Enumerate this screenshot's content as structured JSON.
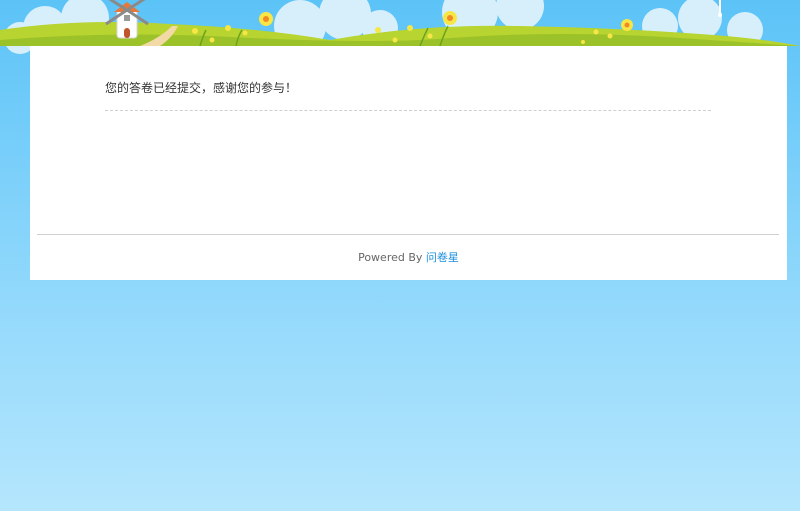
{
  "survey": {
    "submitted_message": "您的答卷已经提交，感谢您的参与！"
  },
  "footer": {
    "powered_by_text": "Powered By",
    "brand_link_text": "问卷星"
  },
  "decorations": {
    "scene": "cartoon-meadow-banner",
    "icons": [
      "windmill-icon",
      "flower-icon",
      "cloud-icon"
    ]
  },
  "colors": {
    "sky_top": "#5cc3f7",
    "sky_bottom": "#b5e6fd",
    "grass": "#b8d430",
    "link": "#1e8fdd"
  }
}
